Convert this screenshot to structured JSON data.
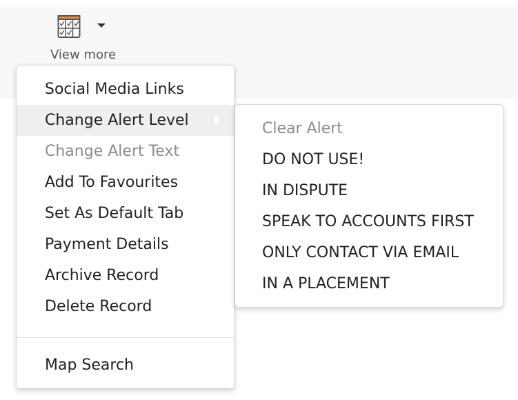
{
  "toolbar": {
    "view_more_label": "View more",
    "view_more_icon": "calendar-check-icon",
    "dropdown_icon": "caret-down-icon"
  },
  "menu": {
    "items": [
      {
        "label": "Social Media Links",
        "enabled": true
      },
      {
        "label": "Change Alert Level",
        "enabled": true,
        "active": true,
        "has_submenu": true
      },
      {
        "label": "Change Alert Text",
        "enabled": false
      },
      {
        "label": "Add To Favourites",
        "enabled": true
      },
      {
        "label": "Set As Default Tab",
        "enabled": true
      },
      {
        "label": "Payment Details",
        "enabled": true
      },
      {
        "label": "Archive Record",
        "enabled": true
      },
      {
        "label": "Delete Record",
        "enabled": true
      },
      {
        "label": "Map Search",
        "enabled": true
      }
    ]
  },
  "submenu": {
    "items": [
      {
        "label": "Clear Alert",
        "enabled": false
      },
      {
        "label": "DO NOT USE!",
        "enabled": true
      },
      {
        "label": "IN DISPUTE",
        "enabled": true
      },
      {
        "label": "SPEAK TO ACCOUNTS FIRST",
        "enabled": true
      },
      {
        "label": "ONLY CONTACT VIA EMAIL",
        "enabled": true
      },
      {
        "label": "IN A PLACEMENT",
        "enabled": true
      }
    ]
  },
  "colors": {
    "icon_accent": "#e8903a",
    "icon_outline": "#555555",
    "disabled_text": "#8c8c8c",
    "active_background": "#efefef"
  }
}
